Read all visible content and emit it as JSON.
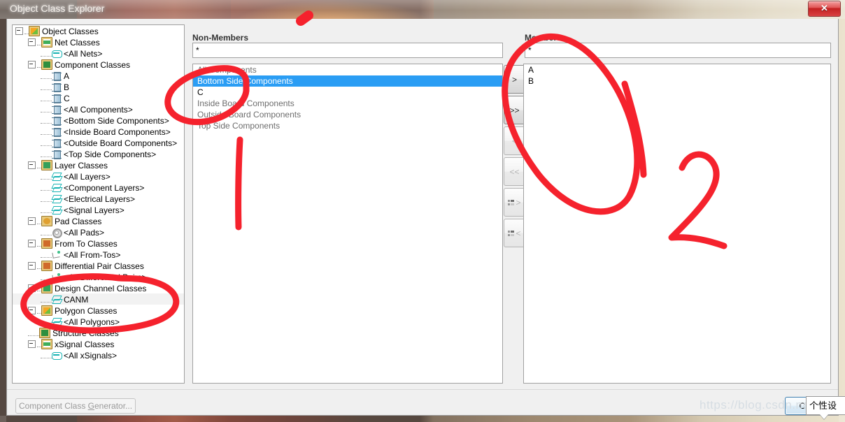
{
  "window": {
    "title": "Object Class Explorer",
    "close_glyph": "✕"
  },
  "tree": {
    "nodes": [
      {
        "label": "Object Classes",
        "indent": 0,
        "icon": "folder-object-classes-icon",
        "expander": "minus"
      },
      {
        "label": "Net Classes",
        "indent": 1,
        "icon": "folder-net-classes-icon",
        "expander": "minus"
      },
      {
        "label": "<All Nets>",
        "indent": 2,
        "icon": "net-icon",
        "expander": ""
      },
      {
        "label": "Component Classes",
        "indent": 1,
        "icon": "folder-component-classes-icon",
        "expander": "minus"
      },
      {
        "label": "A",
        "indent": 2,
        "icon": "component-icon",
        "expander": ""
      },
      {
        "label": "B",
        "indent": 2,
        "icon": "component-icon",
        "expander": ""
      },
      {
        "label": "C",
        "indent": 2,
        "icon": "component-icon",
        "expander": ""
      },
      {
        "label": "<All Components>",
        "indent": 2,
        "icon": "component-icon",
        "expander": ""
      },
      {
        "label": "<Bottom Side Components>",
        "indent": 2,
        "icon": "component-icon",
        "expander": ""
      },
      {
        "label": "<Inside Board Components>",
        "indent": 2,
        "icon": "component-icon",
        "expander": ""
      },
      {
        "label": "<Outside Board Components>",
        "indent": 2,
        "icon": "component-icon",
        "expander": ""
      },
      {
        "label": "<Top Side Components>",
        "indent": 2,
        "icon": "component-icon",
        "expander": ""
      },
      {
        "label": "Layer Classes",
        "indent": 1,
        "icon": "folder-layer-classes-icon",
        "expander": "minus"
      },
      {
        "label": "<All Layers>",
        "indent": 2,
        "icon": "layer-icon",
        "expander": ""
      },
      {
        "label": "<Component Layers>",
        "indent": 2,
        "icon": "layer-icon",
        "expander": ""
      },
      {
        "label": "<Electrical Layers>",
        "indent": 2,
        "icon": "layer-icon",
        "expander": ""
      },
      {
        "label": "<Signal Layers>",
        "indent": 2,
        "icon": "layer-icon",
        "expander": ""
      },
      {
        "label": "Pad Classes",
        "indent": 1,
        "icon": "folder-pad-classes-icon",
        "expander": "minus"
      },
      {
        "label": "<All Pads>",
        "indent": 2,
        "icon": "pad-icon",
        "expander": ""
      },
      {
        "label": "From To Classes",
        "indent": 1,
        "icon": "folder-from-to-classes-icon",
        "expander": "minus"
      },
      {
        "label": "<All From-Tos>",
        "indent": 2,
        "icon": "from-to-icon",
        "expander": ""
      },
      {
        "label": "Differential Pair Classes",
        "indent": 1,
        "icon": "folder-diff-pair-classes-icon",
        "expander": "minus"
      },
      {
        "label": "<All Differential Pairs>",
        "indent": 2,
        "icon": "from-to-icon",
        "expander": ""
      },
      {
        "label": "Design Channel Classes",
        "indent": 1,
        "icon": "folder-design-channel-classes-icon",
        "expander": "minus"
      },
      {
        "label": "CANM",
        "indent": 2,
        "icon": "layer-icon",
        "expander": "",
        "selected": true
      },
      {
        "label": "Polygon Classes",
        "indent": 1,
        "icon": "folder-polygon-classes-icon",
        "expander": "minus"
      },
      {
        "label": "<All Polygons>",
        "indent": 2,
        "icon": "layer-icon",
        "expander": ""
      },
      {
        "label": "Structure Classes",
        "indent": 1,
        "icon": "folder-structure-classes-icon",
        "expander": ""
      },
      {
        "label": "xSignal Classes",
        "indent": 1,
        "icon": "folder-xsignal-classes-icon",
        "expander": "minus"
      },
      {
        "label": "<All xSignals>",
        "indent": 2,
        "icon": "net-icon",
        "expander": ""
      }
    ]
  },
  "non_members": {
    "label": "Non-Members",
    "filter_value": "*",
    "filter_placeholder": "*",
    "items": [
      {
        "label": "All Components",
        "state": "normal"
      },
      {
        "label": "Bottom Side Components",
        "state": "selected"
      },
      {
        "label": "C",
        "state": "dark"
      },
      {
        "label": "Inside Board Components",
        "state": "normal"
      },
      {
        "label": "Outside Board Components",
        "state": "normal"
      },
      {
        "label": "Top Side Components",
        "state": "normal"
      }
    ]
  },
  "members": {
    "label": "Members",
    "filter_value": "*",
    "filter_placeholder": "*",
    "items": [
      {
        "label": "A",
        "state": "dark"
      },
      {
        "label": "B",
        "state": "dark"
      }
    ]
  },
  "transfer_buttons": [
    {
      "name": "add-selected-button",
      "glyph": ">",
      "enabled": true,
      "mini": false
    },
    {
      "name": "add-all-button",
      "glyph": ">>",
      "enabled": true,
      "mini": false
    },
    {
      "name": "remove-selected-button",
      "glyph": "<",
      "enabled": false,
      "mini": false
    },
    {
      "name": "remove-all-button",
      "glyph": "<<",
      "enabled": false,
      "mini": false
    },
    {
      "name": "add-filtered-button",
      "glyph": ">",
      "enabled": false,
      "mini": true
    },
    {
      "name": "remove-filtered-button",
      "glyph": "<",
      "enabled": false,
      "mini": true
    }
  ],
  "footer": {
    "generator_button_pre": "Component Class ",
    "generator_button_accel": "G",
    "generator_button_post": "enerator...",
    "close_button": "Close"
  },
  "overlay": {
    "watermark": "https://blog.csdn.net",
    "tooltip": "个性设",
    "annotation_1": "1",
    "annotation_2": "2"
  },
  "colors": {
    "selection_blue": "#2a9df4",
    "marker_red": "#f5222d",
    "window_chrome": "#f0f0f0",
    "close_red": "#c32020"
  }
}
